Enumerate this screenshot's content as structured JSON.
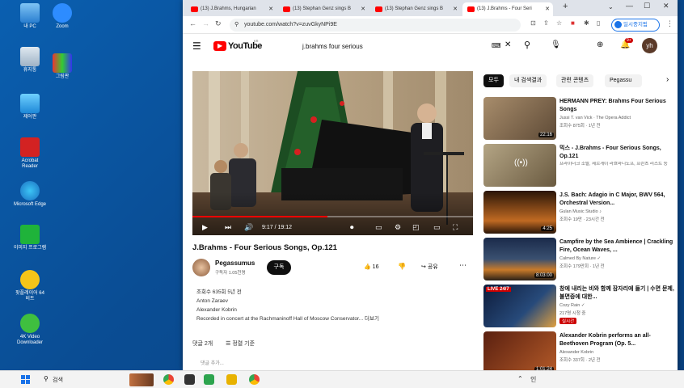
{
  "desktop": {
    "icons": [
      {
        "label": "내 PC"
      },
      {
        "label": "Zoom"
      },
      {
        "label": "휴지통"
      },
      {
        "label": "그림판"
      },
      {
        "label": "제어판"
      },
      {
        "label": "Acrobat Reader"
      },
      {
        "label": "Microsoft Edge"
      },
      {
        "label": "이미지 프로그램"
      },
      {
        "label": "팟플레이어 64 비트"
      },
      {
        "label": "4K Video Downloader"
      }
    ]
  },
  "browser": {
    "tabs": [
      {
        "label": "(13) J.Brahms, Hungarian"
      },
      {
        "label": "(13) Stephan Genz sings B"
      },
      {
        "label": "(13) Stephan Genz sings B"
      },
      {
        "label": "(13) J.Brahms - Four Seri"
      }
    ],
    "url": "youtube.com/watch?v=zuvGkyNPi9E",
    "profile_label": "일시중지됨"
  },
  "youtube": {
    "logo": "YouTube",
    "logo_sup": "KR",
    "search_value": "j.brahms four serious",
    "notif_count": "9+",
    "avatar": "yh",
    "player": {
      "time": "9:17 / 19:12",
      "progress": 0.48
    },
    "video_title": "J.Brahms - Four Serious Songs, Op.121",
    "channel": {
      "name": "Pegassumus",
      "subs": "구독자 1.05천명",
      "subscribe": "구독"
    },
    "likes": "16",
    "share": "공유",
    "description": {
      "meta": "조회수 635회  5년 전",
      "lines": [
        "Anton Zaraev",
        "Alexander Kobrin",
        "Recorded in concert at the Rachmaninoff Hall of Moscow Conservator..."
      ],
      "more": "더보기"
    },
    "comments": {
      "count": "댓글 2개",
      "sort": "정렬 기준",
      "add": "댓글 추가..."
    },
    "chips": [
      "모두",
      "내 검색결과",
      "관련 콘텐츠",
      "Pegassu"
    ],
    "recommendations": [
      {
        "title": "HERMANN PREY: Brahms Four Serious Songs",
        "channel": "Jussi T. van Vick · The Opera Addict",
        "meta": "조회수 875회 · 1년 전",
        "duration": "22:16",
        "live": ""
      },
      {
        "title": "믹스 - J.Brahms - Four Serious Songs, Op.121",
        "channel": "프라이더크 소발, 세르게이 라흐마니노프, 프란츠 리스트 등",
        "meta": "",
        "duration": "",
        "live": ""
      },
      {
        "title": "J.S. Bach: Adagio in C Major, BWV 564, Orchestral Version...",
        "channel": "Gulan Music Studio ♪",
        "meta": "조회수 19만 · 23시간 전",
        "duration": "4:25",
        "live": ""
      },
      {
        "title": "Campfire by the Sea Ambience | Crackling Fire, Ocean Waves, ...",
        "channel": "Calmed By Nature ✓",
        "meta": "조회수 179만회 · 1년 전",
        "duration": "8:03:00",
        "live": ""
      },
      {
        "title": "창에 내리는 비와 함께 잠자리에 들기 | 수면 문제, 불면증에 대한...",
        "channel": "Cozy Rain ✓",
        "meta": "217명 시청 중",
        "duration": "",
        "live": "LIVE 24/7",
        "badge": "실시간"
      },
      {
        "title": "Alexander Kobrin performs an all-Beethoven Program (Op. 5...",
        "channel": "Alexander Kobrin",
        "meta": "조회수 337회 · 2년 전",
        "duration": "1:01:24",
        "live": ""
      }
    ]
  },
  "taskbar": {
    "search": "검색",
    "tray": "인"
  }
}
